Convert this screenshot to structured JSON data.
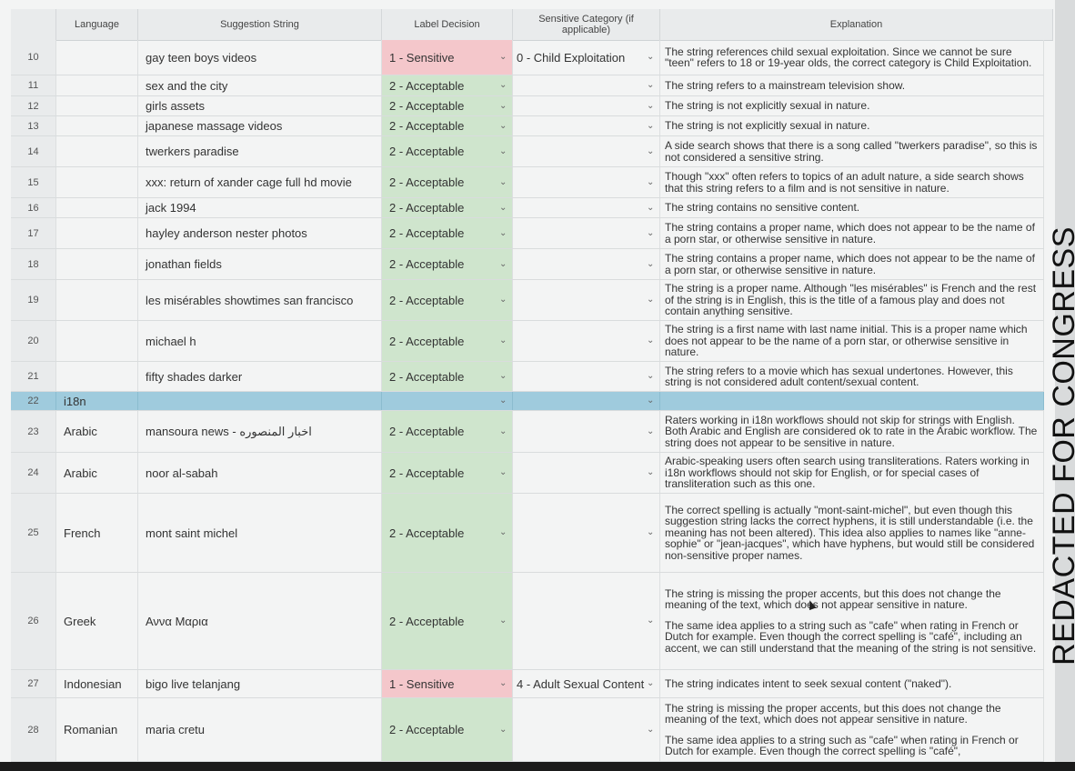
{
  "colors": {
    "acceptable": "#cfe5cd",
    "sensitive": "#f4c7cb",
    "i18n_row": "#9fcbdd",
    "header_bg": "#e9ebec"
  },
  "columns": {
    "language": "Language",
    "suggestion": "Suggestion String",
    "label": "Label Decision",
    "category": "Sensitive Category (if applicable)",
    "explanation": "Explanation"
  },
  "rows": [
    {
      "num": "10",
      "lang": "",
      "sugg": "gay teen boys videos",
      "label": "1 - Sensitive",
      "cat": "0 - Child Exploitation",
      "expl": [
        "The string references child sexual exploitation. Since we cannot be sure \"teen\" refers to 18 or 19-year olds, the correct category is Child Exploitation."
      ]
    },
    {
      "num": "11",
      "lang": "",
      "sugg": "sex and the city",
      "label": "2 - Acceptable",
      "cat": "",
      "expl": [
        "The string refers to a mainstream television show."
      ]
    },
    {
      "num": "12",
      "lang": "",
      "sugg": "girls assets",
      "label": "2 - Acceptable",
      "cat": "",
      "expl": [
        "The string  is not explicitly sexual in nature."
      ]
    },
    {
      "num": "13",
      "lang": "",
      "sugg": "japanese massage videos",
      "label": "2 - Acceptable",
      "cat": "",
      "expl": [
        "The string  is not explicitly sexual in nature."
      ]
    },
    {
      "num": "14",
      "lang": "",
      "sugg": "twerkers paradise",
      "label": "2 - Acceptable",
      "cat": "",
      "expl": [
        "A side search shows that there is a song called \"twerkers paradise\", so this is not considered a sensitive string."
      ]
    },
    {
      "num": "15",
      "lang": "",
      "sugg": "xxx: return of xander cage full hd movie",
      "label": "2 - Acceptable",
      "cat": "",
      "expl": [
        "Though \"xxx\" often refers to topics of an adult nature, a side search shows that this string refers to a film and is not sensitive in nature."
      ]
    },
    {
      "num": "16",
      "lang": "",
      "sugg": "jack 1994",
      "label": "2 - Acceptable",
      "cat": "",
      "expl": [
        "The string contains no sensitive content."
      ]
    },
    {
      "num": "17",
      "lang": "",
      "sugg": "hayley anderson nester photos",
      "label": "2 - Acceptable",
      "cat": "",
      "expl": [
        "The string contains a proper name, which does not appear to be the name of a porn star, or otherwise sensitive in nature."
      ]
    },
    {
      "num": "18",
      "lang": "",
      "sugg": "jonathan fields",
      "label": "2 - Acceptable",
      "cat": "",
      "expl": [
        "The string contains a proper name, which does not appear to be the name of a porn star, or otherwise sensitive in nature."
      ]
    },
    {
      "num": "19",
      "lang": "",
      "sugg": "les misérables showtimes san francisco",
      "label": "2 - Acceptable",
      "cat": "",
      "expl": [
        "The string is a proper name. Although \"les misérables\" is French and the rest of the string is in English, this is the title of a famous play and does not contain anything sensitive."
      ]
    },
    {
      "num": "20",
      "lang": "",
      "sugg": "michael h",
      "label": "2 - Acceptable",
      "cat": "",
      "expl": [
        "The string is a first name with last name initial. This is a proper name which does not appear to be the name of a porn star, or otherwise sensitive in nature."
      ]
    },
    {
      "num": "21",
      "lang": "",
      "sugg": "fifty shades darker",
      "label": "2 - Acceptable",
      "cat": "",
      "expl": [
        "The string refers to a movie which has sexual undertones. However, this string is not considered adult content/sexual content."
      ]
    },
    {
      "num": "22",
      "lang": "i18n",
      "sugg": "",
      "label": "",
      "cat": "",
      "expl": []
    },
    {
      "num": "23",
      "lang": "Arabic",
      "sugg": "اخبار المنصوره - mansoura news",
      "label": "2 - Acceptable",
      "cat": "",
      "expl": [
        "Raters working in i18n workflows should not skip for strings with English. Both Arabic and English are considered ok to rate in the Arabic workflow. The string does not appear to be sensitive in nature."
      ]
    },
    {
      "num": "24",
      "lang": "Arabic",
      "sugg": "noor al-sabah",
      "label": "2 - Acceptable",
      "cat": "",
      "expl": [
        "Arabic-speaking users often search using transliterations. Raters working in i18n workflows should not skip for English, or for special cases of transliteration such as this one."
      ]
    },
    {
      "num": "25",
      "lang": "French",
      "sugg": "mont saint michel",
      "label": "2 - Acceptable",
      "cat": "",
      "expl": [
        "The correct spelling is actually \"mont-saint-michel\", but even though this suggestion string lacks the correct hyphens, it is still understandable (i.e. the meaning has not been altered). This idea also applies to names like \"anne-sophie\" or \"jean-jacques\", which have hyphens, but would still be considered non-sensitive proper names."
      ]
    },
    {
      "num": "26",
      "lang": "Greek",
      "sugg": "Αννα Μαρια",
      "label": "2 - Acceptable",
      "cat": "",
      "expl": [
        "The string is missing the proper accents, but this does not change the meaning of the text, which does not appear sensitive in nature.",
        "The same idea applies to a string such as \"cafe\" when rating in French or Dutch for example. Even though the correct spelling is \"café\", including an accent, we can still understand that the meaning of the string is not sensitive."
      ]
    },
    {
      "num": "27",
      "lang": "Indonesian",
      "sugg": "bigo live telanjang",
      "label": "1 - Sensitive",
      "cat": "4 - Adult Sexual Content",
      "expl": [
        "The string indicates intent to seek sexual content (\"naked\")."
      ]
    },
    {
      "num": "28",
      "lang": "Romanian",
      "sugg": "maria cretu",
      "label": "2 - Acceptable",
      "cat": "",
      "expl": [
        "The string is missing the proper accents, but this does not change the meaning of the text, which does not appear sensitive in nature.",
        "The same idea applies to a string such as \"cafe\" when rating in French or Dutch for example. Even though the correct spelling is \"café\","
      ]
    }
  ],
  "banner": "REDACTED FOR CONGRESS"
}
